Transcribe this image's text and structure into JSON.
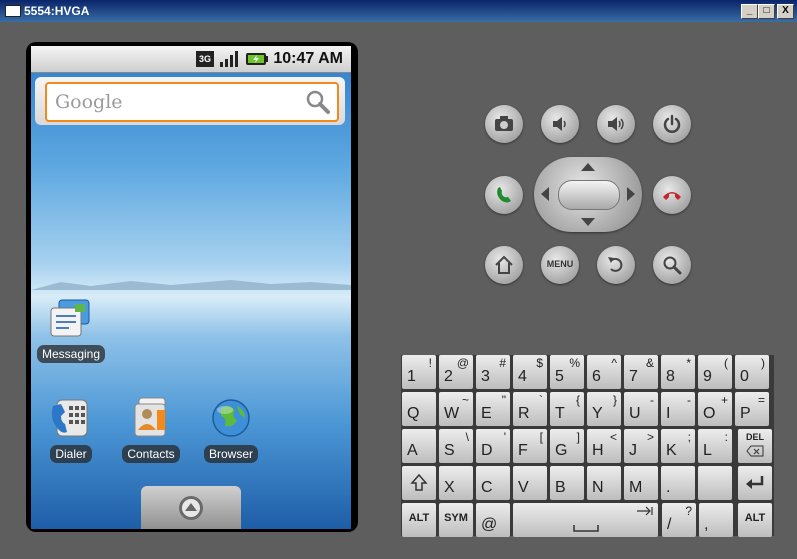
{
  "window": {
    "title": "5554:HVGA",
    "minimize": "_",
    "maximize": "□",
    "close": "X"
  },
  "status_bar": {
    "network": "3G",
    "time": "10:47 AM"
  },
  "search": {
    "placeholder": "Google"
  },
  "apps": {
    "messaging": "Messaging",
    "dialer": "Dialer",
    "contacts": "Contacts",
    "browser": "Browser"
  },
  "controls": {
    "menu_label": "MENU"
  },
  "keyboard": {
    "row1": [
      [
        "1",
        "!"
      ],
      [
        "2",
        "@"
      ],
      [
        "3",
        "#"
      ],
      [
        "4",
        "$"
      ],
      [
        "5",
        "%"
      ],
      [
        "6",
        "^"
      ],
      [
        "7",
        "&"
      ],
      [
        "8",
        "*"
      ],
      [
        "9",
        "("
      ],
      [
        "0",
        ")"
      ]
    ],
    "row2": [
      [
        "Q",
        ""
      ],
      [
        "W",
        "~"
      ],
      [
        "E",
        "\""
      ],
      [
        "R",
        "`"
      ],
      [
        "T",
        "{"
      ],
      [
        "Y",
        "}"
      ],
      [
        "U",
        "-"
      ],
      [
        "I",
        "-"
      ],
      [
        "O",
        "+"
      ],
      [
        "P",
        "="
      ]
    ],
    "row3": [
      [
        "A",
        ""
      ],
      [
        "S",
        "\\"
      ],
      [
        "D",
        "'"
      ],
      [
        "F",
        "["
      ],
      [
        "G",
        "]"
      ],
      [
        "H",
        "<"
      ],
      [
        "J",
        ">"
      ],
      [
        "K",
        ";"
      ],
      [
        "L",
        ":"
      ]
    ],
    "del_label": "DEL",
    "row4": [
      "Z",
      "X",
      "C",
      "V",
      "B",
      "N",
      "M",
      "."
    ],
    "alt_label": "ALT",
    "sym_label": "SYM",
    "at_key": "@",
    "slash_key": "/",
    "slash_alt": "?",
    "comma_key": ","
  }
}
